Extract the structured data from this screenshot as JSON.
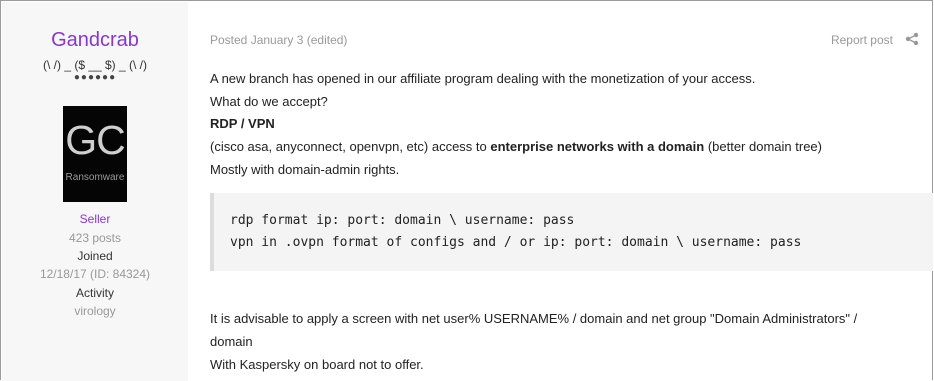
{
  "author": {
    "username": "Gandcrab",
    "tagline": "(\\ /) _ ($ __ $) _ (\\ /)",
    "rank_dots": "●●●●●●",
    "avatar_text": "GC",
    "avatar_subtext": "Ransomware",
    "group": "Seller",
    "posts": "423 posts",
    "joined_label": "Joined",
    "joined_value": "12/18/17 (ID: 84324)",
    "activity_label": "Activity",
    "activity_value": "virology"
  },
  "post": {
    "posted": "Posted January 3 (edited)",
    "report_label": "Report post",
    "share_icon": "share-icon",
    "line1": "A new branch has opened in our affiliate program dealing with the monetization of your access.",
    "line2": "What do we accept?",
    "line3": "RDP / VPN",
    "line4_pre": "(cisco asa, anyconnect, openvpn, etc) access to ",
    "line4_bold": "enterprise networks with a domain",
    "line4_post": " (better domain tree)",
    "line5": "Mostly with domain-admin rights.",
    "code_line1": "rdp format ip: port: domain \\ username: pass",
    "code_line2": "vpn in .ovpn format of configs and / or ip: port: domain \\ username: pass",
    "line6": "It is advisable to apply a screen with net user% USERNAME% / domain and net group \"Domain Administrators\" /",
    "line7": "domain",
    "line8": "With Kaspersky on board not to offer."
  },
  "colors": {
    "username": "#8b35cf",
    "muted": "#999999",
    "sidebar_bg": "#f7f7f7",
    "code_bg": "#f4f4f4"
  }
}
